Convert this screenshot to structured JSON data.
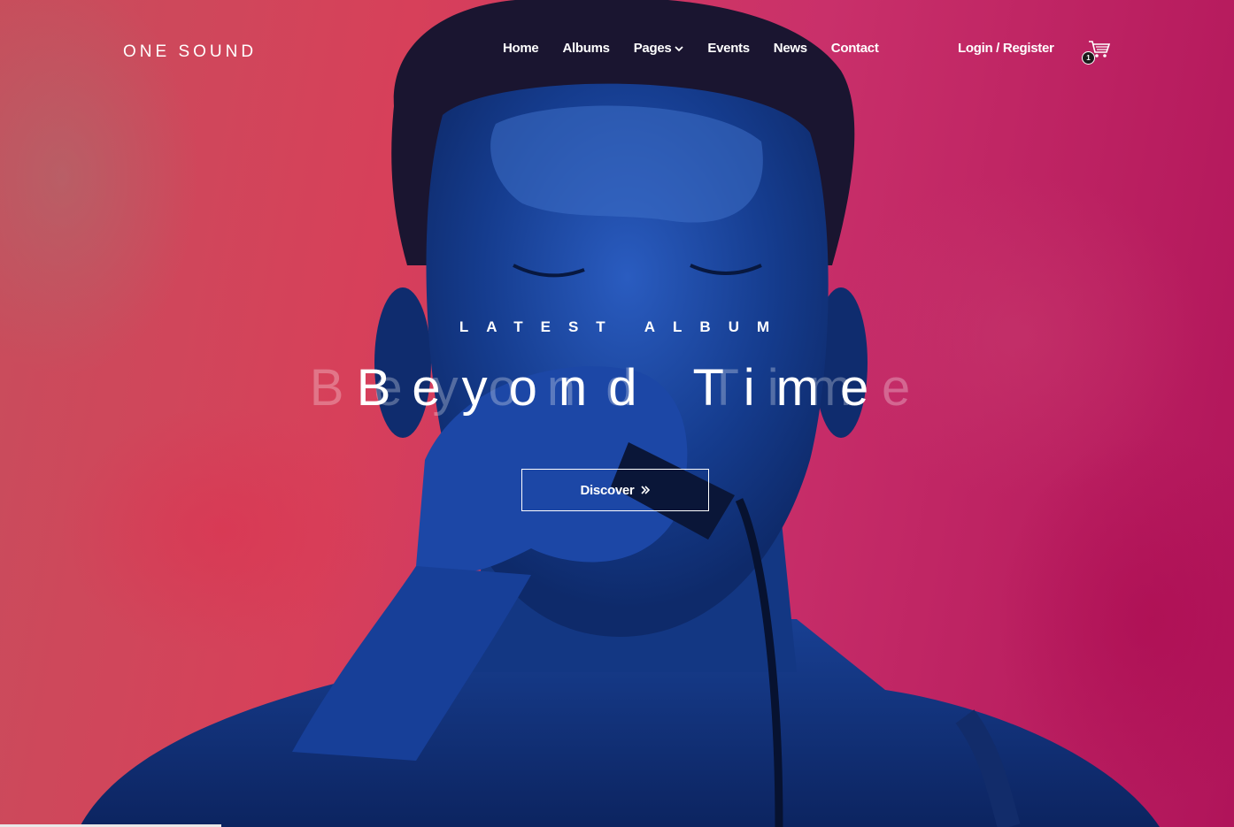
{
  "brand": {
    "logo": "ONE SOUND"
  },
  "nav": {
    "items": [
      {
        "label": "Home"
      },
      {
        "label": "Albums"
      },
      {
        "label": "Pages",
        "has_dropdown": true
      },
      {
        "label": "Events"
      },
      {
        "label": "News"
      },
      {
        "label": "Contact"
      }
    ],
    "login_label": "Login / Register",
    "cart": {
      "icon": "cart-icon",
      "count": "1"
    }
  },
  "hero": {
    "eyebrow": "LATEST ALBUM",
    "title": "Beyond Time",
    "button_label": "Discover",
    "button_icon": "double-chevron-right-icon"
  },
  "colors": {
    "background_left": "#c74e5c",
    "background_right": "#b0145a",
    "overlay_blue": "#1a3f8f",
    "text": "#ffffff"
  }
}
